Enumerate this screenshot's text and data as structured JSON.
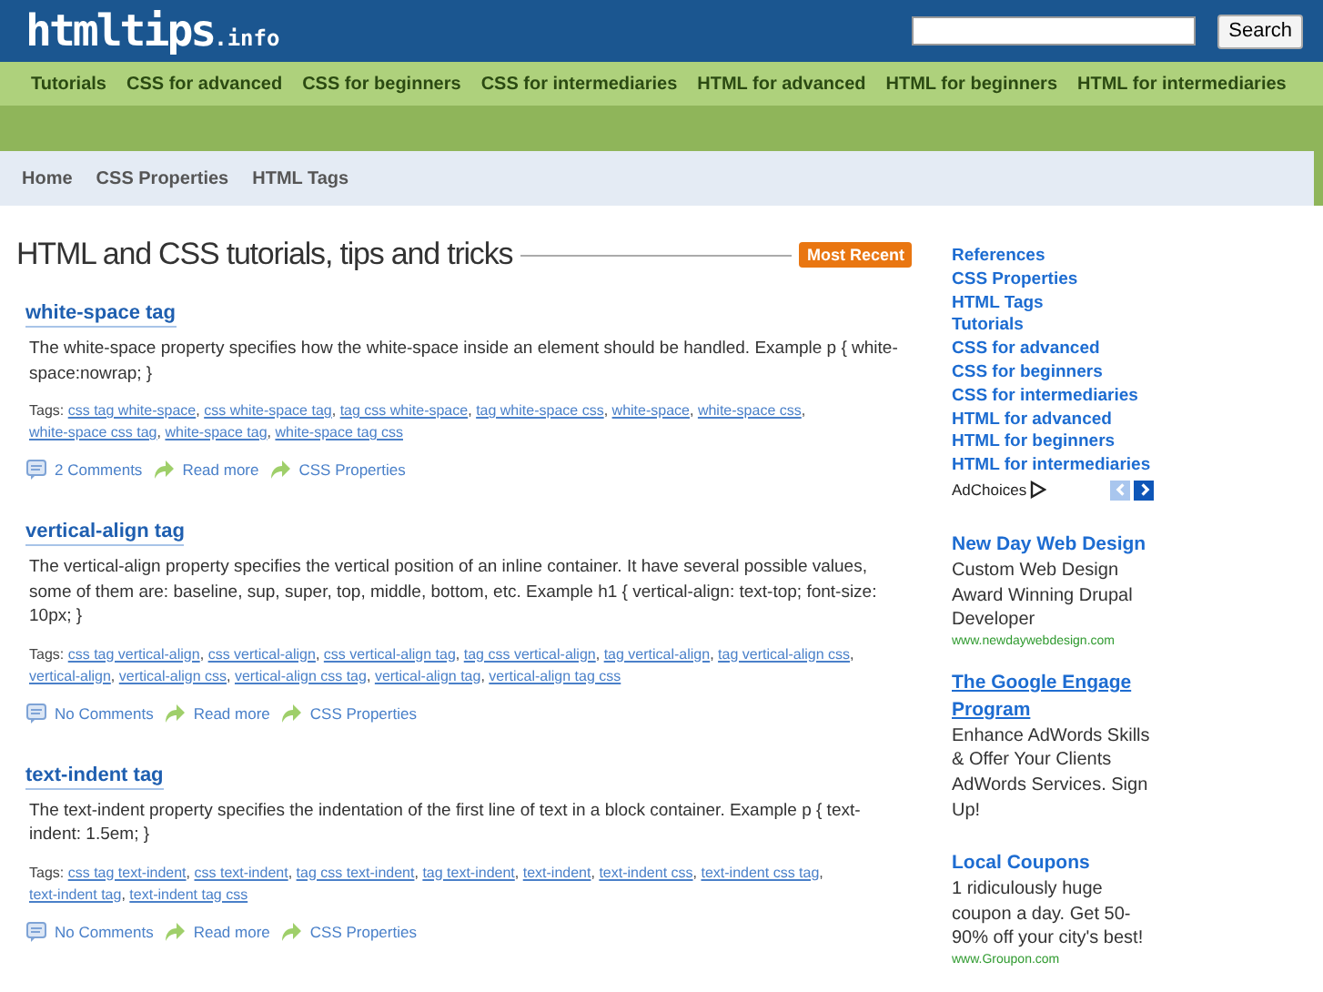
{
  "header": {
    "logo": "htmltips",
    "logo_suffix": ".info",
    "search_button": "Search"
  },
  "nav": [
    "Tutorials",
    "CSS for advanced",
    "CSS for beginners",
    "CSS for intermediaries",
    "HTML for advanced",
    "HTML for beginners",
    "HTML for intermediaries"
  ],
  "breadcrumb_nav": [
    "Home",
    "CSS Properties",
    "HTML Tags"
  ],
  "main": {
    "heading": "HTML and CSS tutorials, tips and tricks",
    "badge": "Most Recent",
    "posts": [
      {
        "title": "white-space tag",
        "body": "The white-space property specifies how the white-space inside an element should be handled. Example p { white-space:nowrap; }",
        "tags_label": "Tags:",
        "tags": [
          {
            "text": "css tag white-space",
            "sep": ","
          },
          {
            "text": "css white-space tag",
            "sep": ","
          },
          {
            "text": "tag css white-space",
            "sep": ","
          },
          {
            "text": "tag white-space css",
            "sep": ","
          },
          {
            "text": "white-space",
            "sep": ","
          },
          {
            "text": "white-space css",
            "sep": ","
          },
          {
            "text": "white-space css tag",
            "sep": ","
          },
          {
            "text": "white-space tag",
            "sep": ","
          },
          {
            "text": "white-space tag css"
          }
        ],
        "comments": "2 Comments",
        "read_more": "Read more",
        "category": "CSS Properties"
      },
      {
        "title": "vertical-align tag",
        "body": "The vertical-align property specifies the vertical position of an inline container. It have several possible values, some of them are: baseline, sup, super, top, middle, bottom, etc. Example h1 { vertical-align: text-top; font-size: 10px; }",
        "tags_label": "Tags:",
        "tags": [
          {
            "text": "css tag vertical-align",
            "sep": ","
          },
          {
            "text": "css vertical-align",
            "sep": ","
          },
          {
            "text": "css vertical-align tag",
            "sep": ","
          },
          {
            "text": "tag css vertical-align",
            "sep": ","
          },
          {
            "text": "tag vertical-align",
            "sep": ","
          },
          {
            "text": "tag vertical-align css",
            "sep": ","
          },
          {
            "text": "vertical-align",
            "sep": ","
          },
          {
            "text": "vertical-align css",
            "sep": ","
          },
          {
            "text": "vertical-align css tag",
            "sep": ","
          },
          {
            "text": "vertical-align tag",
            "sep": ","
          },
          {
            "text": "vertical-align tag css"
          }
        ],
        "comments": "No Comments",
        "read_more": "Read more",
        "category": "CSS Properties"
      },
      {
        "title": "text-indent tag",
        "body": "The text-indent property specifies the indentation of the first line of text in a block container. Example p { text-indent: 1.5em; }",
        "tags_label": "Tags:",
        "tags": [
          {
            "text": "css tag text-indent",
            "sep": ","
          },
          {
            "text": "css text-indent",
            "sep": ","
          },
          {
            "text": "tag css text-indent",
            "sep": ","
          },
          {
            "text": "tag text-indent",
            "sep": ","
          },
          {
            "text": "text-indent",
            "sep": ","
          },
          {
            "text": "text-indent css",
            "sep": ","
          },
          {
            "text": "text-indent css tag",
            "sep": ","
          },
          {
            "text": "text-indent tag",
            "sep": ","
          },
          {
            "text": "text-indent tag css"
          }
        ],
        "comments": "No Comments",
        "read_more": "Read more",
        "category": "CSS Properties"
      }
    ]
  },
  "sidebar": {
    "links": [
      "References",
      "CSS Properties",
      "HTML Tags",
      "Tutorials",
      "CSS for advanced",
      "CSS for beginners",
      "CSS for intermediaries",
      "HTML for advanced",
      "HTML for beginners",
      "HTML for intermediaries"
    ],
    "adchoices": "AdChoices",
    "prev_disabled": true,
    "next_disabled": false,
    "ads": [
      {
        "title": "New Day Web Design",
        "body": "Custom Web Design Award Winning Drupal Developer",
        "url": "www.newdaywebdesign.com"
      },
      {
        "title": "The Google Engage Program",
        "underlined": true,
        "body": "Enhance AdWords Skills & Offer Your Clients AdWords Services. Sign Up!"
      },
      {
        "title": "Local Coupons",
        "body": "1 ridiculously huge coupon a day. Get 50-90% off your city's best!",
        "url": "www.Groupon.com"
      }
    ]
  }
}
